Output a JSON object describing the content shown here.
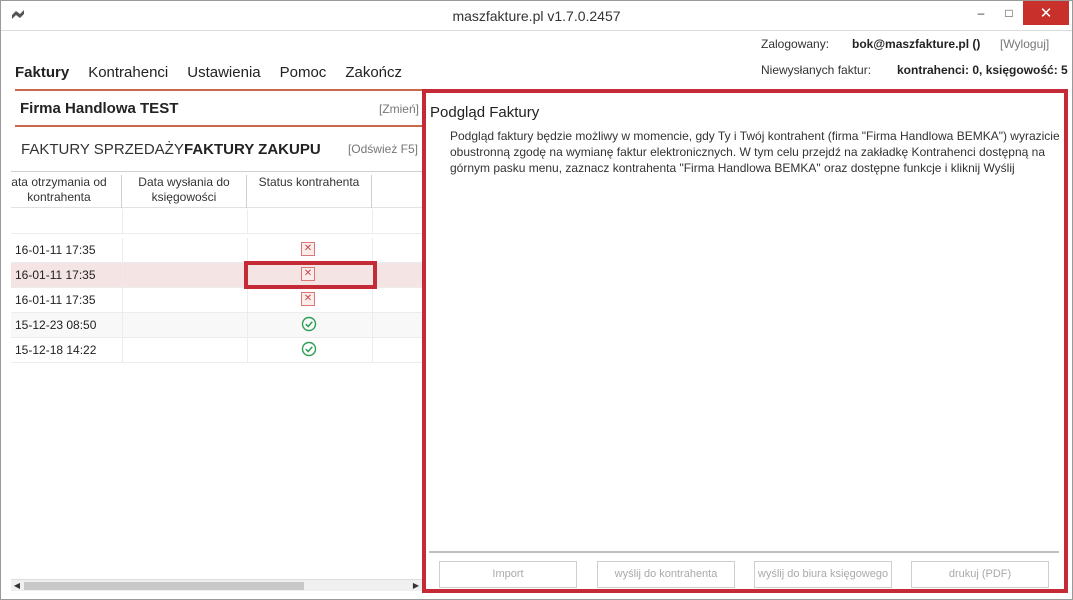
{
  "window": {
    "title": "maszfakture.pl  v1.7.0.2457",
    "min_label": "–",
    "max_label": "□",
    "close_label": "✕"
  },
  "menu": {
    "items": [
      "Faktury",
      "Kontrahenci",
      "Ustawienia",
      "Pomoc",
      "Zakończ"
    ]
  },
  "account": {
    "logged_label": "Zalogowany:",
    "user": "bok@maszfakture.pl ()",
    "logout": "[Wyloguj]",
    "unsent_label": "Niewysłanych faktur:",
    "unsent_value": "kontrahenci: 0, księgowość: 5"
  },
  "company": {
    "name": "Firma Handlowa TEST",
    "change": "[Zmień]"
  },
  "tabs": {
    "sales": "FAKTURY SPRZEDAŻY",
    "purchase": "FAKTURY ZAKUPU",
    "refresh": "[Odśwież F5]"
  },
  "grid": {
    "headers": [
      "ata otrzymania od kontrahenta",
      "Data wysłania do księgowości",
      "Status kontrahenta"
    ],
    "rows": [
      {
        "received": "",
        "sent": "",
        "status": ""
      },
      {
        "received": "16-01-11 17:35",
        "sent": "",
        "status": "error"
      },
      {
        "received": "16-01-11 17:35",
        "sent": "",
        "status": "error"
      },
      {
        "received": "16-01-11 17:35",
        "sent": "",
        "status": "error"
      },
      {
        "received": "15-12-23 08:50",
        "sent": "",
        "status": "ok"
      },
      {
        "received": "15-12-18 14:22",
        "sent": "",
        "status": "ok"
      }
    ]
  },
  "preview": {
    "title": "Podgląd Faktury",
    "text": "Podgląd faktury będzie możliwy w momencie, gdy Ty i Twój kontrahent (firma \"Firma Handlowa BEMKA\") wyrazicie obustronną zgodę na wymianę faktur elektronicznych. W tym celu przejdź na zakładkę Kontrahenci dostępną na górnym pasku menu, zaznacz kontrahenta \"Firma Handlowa BEMKA\" oraz dostępne funkcje i kliknij Wyślij"
  },
  "buttons": {
    "import": "Import",
    "send_contractor": "wyślij do kontrahenta",
    "send_accounting": "wyślij do biura księgowego",
    "print": "drukuj (PDF)"
  },
  "colors": {
    "accent_red": "#c52b37",
    "tab_underline": "#c86a4a",
    "ok_green": "#2e9e52"
  }
}
